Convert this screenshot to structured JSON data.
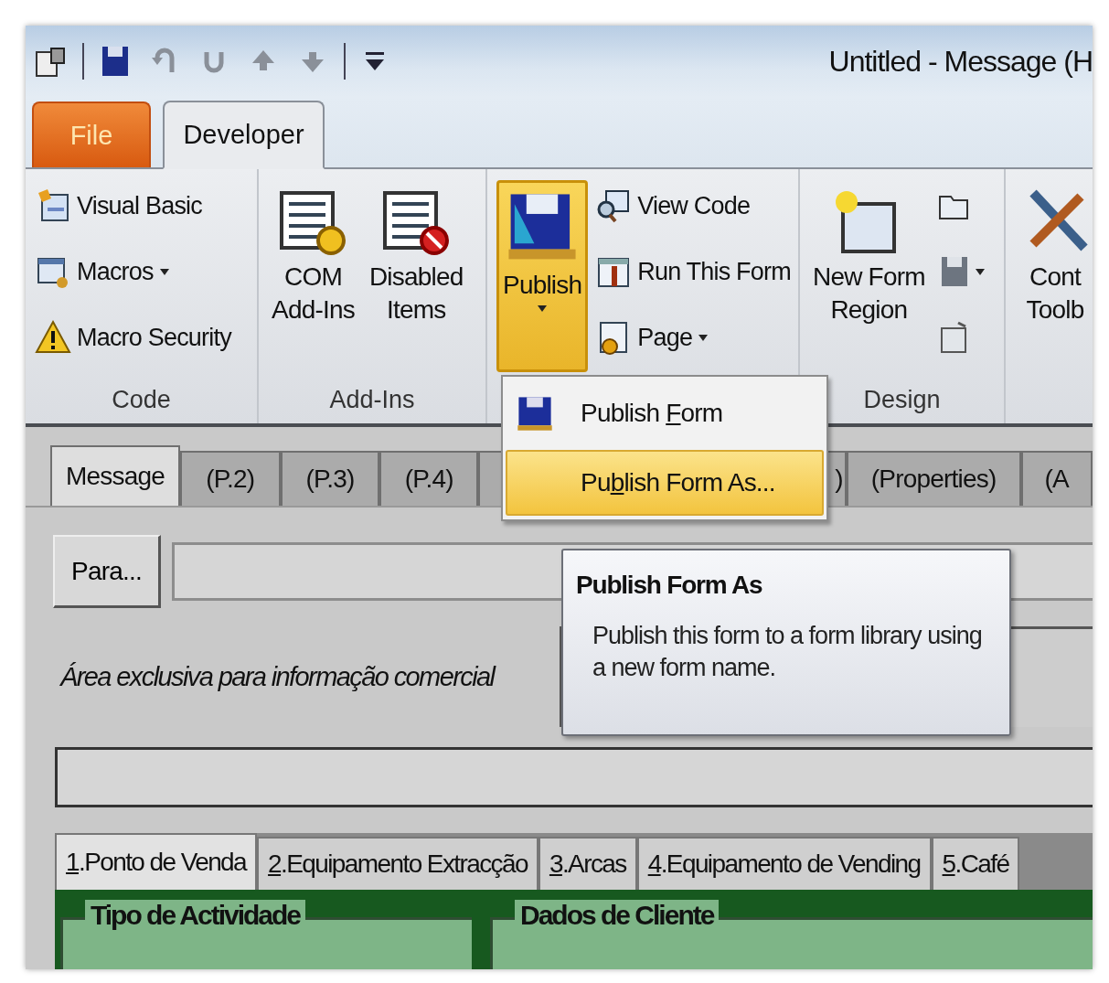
{
  "window": {
    "title": "Untitled - Message (H"
  },
  "ribbon_tabs": [
    {
      "label": "File",
      "kind": "file",
      "selected": false
    },
    {
      "label": "Developer",
      "kind": "tab",
      "selected": true
    }
  ],
  "ribbon_groups": [
    {
      "label": "Code",
      "items": [
        {
          "kind": "small",
          "label": "Visual Basic",
          "dropdown": false
        },
        {
          "kind": "small",
          "label": "Macros",
          "dropdown": true
        },
        {
          "kind": "small",
          "label": "Macro Security",
          "dropdown": false
        }
      ]
    },
    {
      "label": "Add-Ins",
      "items": [
        {
          "kind": "large",
          "lines": [
            "COM",
            "Add-Ins"
          ],
          "pressed": false,
          "dropdown": false
        },
        {
          "kind": "large",
          "lines": [
            "Disabled",
            "Items"
          ],
          "pressed": false,
          "dropdown": false
        }
      ]
    },
    {
      "items": [
        {
          "kind": "large",
          "lines": [
            "Publish"
          ],
          "pressed": true,
          "dropdown": true
        },
        {
          "kind": "small",
          "label": "View Code",
          "dropdown": false
        },
        {
          "kind": "small",
          "label": "Run This Form",
          "dropdown": false
        },
        {
          "kind": "small",
          "label": "Page",
          "dropdown": true
        }
      ]
    },
    {
      "label": "Design",
      "items": [
        {
          "kind": "large",
          "lines": [
            "New Form",
            "Region"
          ],
          "pressed": false,
          "dropdown": false
        },
        {
          "kind": "icon",
          "dropdown": false
        },
        {
          "kind": "icon",
          "dropdown": true
        },
        {
          "kind": "icon",
          "dropdown": false
        }
      ]
    },
    {
      "items": [
        {
          "kind": "large",
          "lines": [
            "Cont",
            "Toolb"
          ],
          "pressed": false,
          "dropdown": false
        }
      ]
    }
  ],
  "publish_menu": {
    "items": [
      {
        "text_before": "Publish ",
        "access_key": "F",
        "text_after": "orm",
        "selected": false
      },
      {
        "text_before": "Pu",
        "access_key": "b",
        "text_after": "lish Form As...",
        "selected": true
      }
    ]
  },
  "tooltip": {
    "title": "Publish Form As",
    "text": "Publish this form to a form library using a new form name."
  },
  "page_tabs": [
    {
      "label": "Message",
      "selected": true
    },
    {
      "label": "(P.2)",
      "selected": false
    },
    {
      "label": "(P.3)",
      "selected": false
    },
    {
      "label": "(P.4)",
      "selected": false
    },
    {
      "label": ")",
      "selected": false
    },
    {
      "label": "(Properties)",
      "selected": false
    },
    {
      "label": "(A",
      "selected": false
    }
  ],
  "to_button": "Para...",
  "note": "Área exclusiva para informação comercial",
  "section_tabs": [
    {
      "access_key": "1",
      "text_after": ".Ponto de Venda",
      "selected": true
    },
    {
      "access_key": "2",
      "text_after": ".Equipamento Extracção",
      "selected": false
    },
    {
      "access_key": "3",
      "text_after": ".Arcas",
      "selected": false
    },
    {
      "access_key": "4",
      "text_after": ".Equipamento de Vending",
      "selected": false
    },
    {
      "access_key": "5",
      "text_after": ".Café",
      "selected": false
    }
  ],
  "frames": [
    {
      "title": "Tipo de Actividade"
    },
    {
      "title": "Dados de Cliente"
    }
  ]
}
